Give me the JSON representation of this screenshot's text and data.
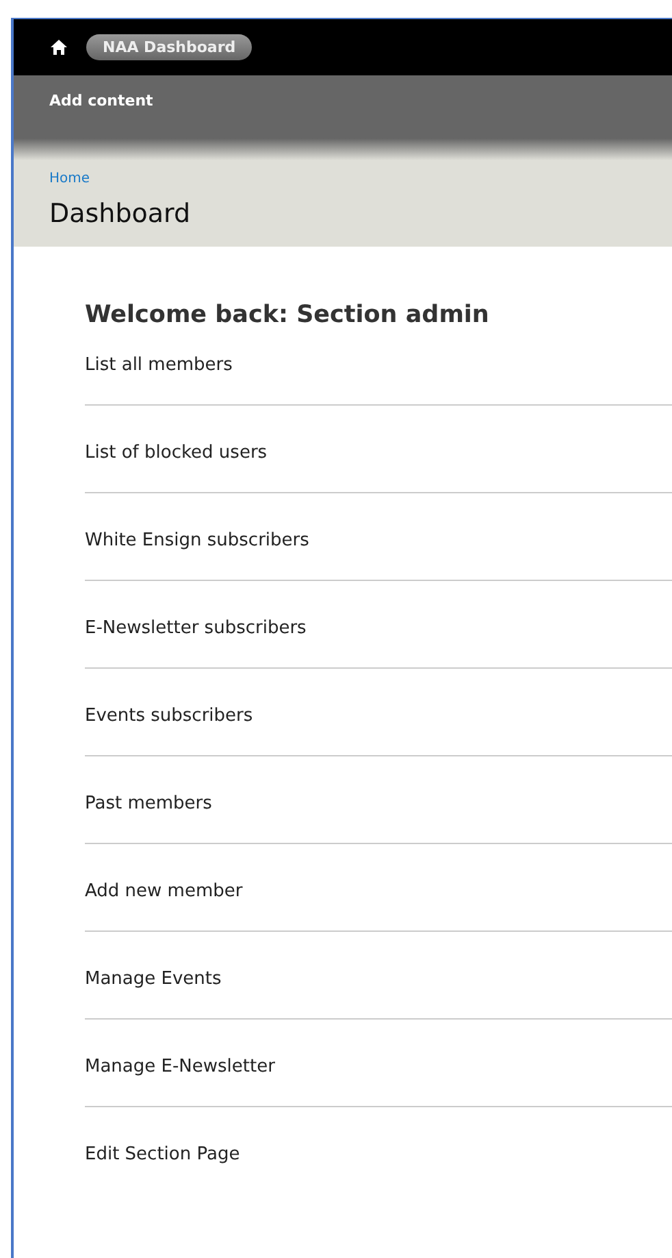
{
  "toolbar": {
    "shortcut": "NAA Dashboard"
  },
  "secondary_toolbar": {
    "link": "Add content"
  },
  "header": {
    "breadcrumb": "Home",
    "title": "Dashboard"
  },
  "welcome": "Welcome back: Section admin",
  "links": [
    "List all members",
    "List of blocked users",
    "White Ensign subscribers",
    "E-Newsletter subscribers",
    "Events subscribers",
    "Past members",
    "Add new member",
    "Manage Events",
    "Manage E-Newsletter",
    "Edit Section Page"
  ]
}
